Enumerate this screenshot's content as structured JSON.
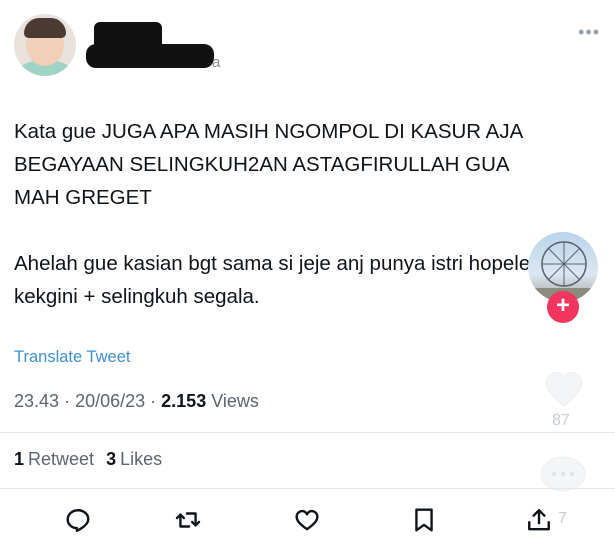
{
  "tweet": {
    "author_handle_visible_tail": "a",
    "more_label": "•••",
    "text_paragraph_1": "Kata gue JUGA APA MASIH NGOMPOL DI KASUR AJA BEGAYAAN SELINGKUH2AN ASTAGFIRULLAH GUA MAH GREGET",
    "text_paragraph_2": "Ahelah gue kasian bgt sama si jeje anj punya istri hopeless kekgini + selingkuh segala.",
    "translate_label": "Translate Tweet",
    "time": "23.43",
    "date": "20/06/23",
    "views_count": "2.153",
    "views_label": "Views",
    "retweet_count": "1",
    "retweet_label": "Retweet",
    "likes_count": "3",
    "likes_label": "Likes"
  },
  "overlay": {
    "plus_label": "+",
    "like_count": "87",
    "share_count": "7"
  },
  "icons": {
    "reply": "reply-icon",
    "retweet": "retweet-icon",
    "like": "heart-icon",
    "bookmark": "bookmark-icon",
    "share": "share-icon"
  },
  "colors": {
    "link": "#3f8fd2",
    "text": "#0f1419",
    "muted": "#5b6670",
    "plus_badge": "#f2355f"
  }
}
